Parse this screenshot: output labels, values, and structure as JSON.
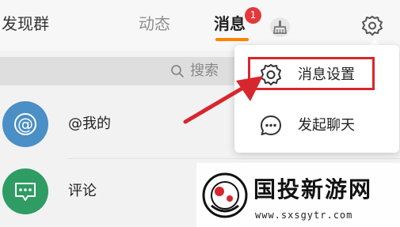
{
  "header": {
    "discover_group": "发现群",
    "tabs": [
      {
        "label": "动态"
      },
      {
        "label": "消息"
      }
    ],
    "unread_badge": "1",
    "clean_icon": "broom-icon",
    "settings_icon": "gear-icon"
  },
  "search": {
    "placeholder": "搜索"
  },
  "list": {
    "items": [
      {
        "label": "@我的",
        "icon": "at-icon"
      },
      {
        "label": "评论",
        "icon": "comment-icon"
      }
    ]
  },
  "dropdown": {
    "items": [
      {
        "label": "消息设置",
        "icon": "gear-icon"
      },
      {
        "label": "发起聊天",
        "icon": "chat-bubble-icon"
      }
    ]
  },
  "watermark": {
    "title": "国投新游网",
    "url": "www.sxsgytr.com"
  },
  "colors": {
    "accent": "#ff8200",
    "highlight": "#d8262e",
    "badge": "#e4393c",
    "at_avatar": "#4a8fc5",
    "comment_avatar": "#2e9c63"
  }
}
